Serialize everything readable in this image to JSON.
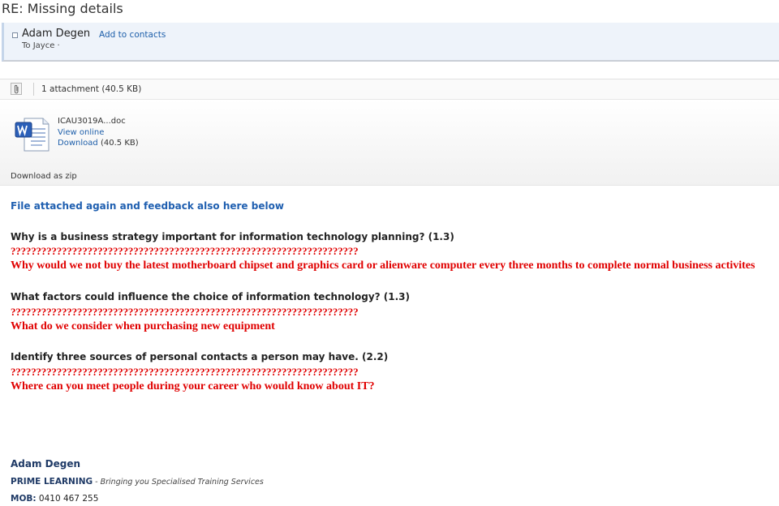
{
  "subject": "RE: Missing details",
  "sender": {
    "name": "Adam Degen",
    "add_to_contacts": "Add to contacts",
    "to_line": "To Jayce ·"
  },
  "attachments": {
    "summary": "1 attachment (40.5 KB)",
    "file": {
      "name": "ICAU3019A...doc",
      "view_online": "View online",
      "download": "Download",
      "size": "(40.5 KB)",
      "icon": "word-document-icon"
    },
    "download_zip": "Download as zip"
  },
  "body": {
    "intro": "File attached again and feedback also here below",
    "questions": [
      {
        "question": "Why is a business strategy important for information technology planning? (1.3)",
        "marks": "????????????????????????????????????????????????????????????????????",
        "feedback": "Why would we not buy the latest motherboard chipset and graphics card or alienware computer every three months to complete normal business activites"
      },
      {
        "question": "What factors could influence the choice of information technology? (1.3)",
        "marks": "????????????????????????????????????????????????????????????????????",
        "feedback": "What do we consider when purchasing new equipment"
      },
      {
        "question": "Identify three sources of personal contacts a person may have. (2.2)",
        "marks": "????????????????????????????????????????????????????????????????????",
        "feedback": "Where can you meet people during your career who would know about IT?"
      }
    ]
  },
  "signature": {
    "name": "Adam Degen",
    "company": "PRIME LEARNING",
    "tagline": " - Bringing you Specialised Training Services",
    "mob_label": "MOB:",
    "mob_number": " 0410 467 255"
  },
  "colors": {
    "link": "#1e5faa",
    "feedback_red": "#e00000",
    "intro_blue": "#1f5fb0",
    "signature_navy": "#1f3a66"
  }
}
